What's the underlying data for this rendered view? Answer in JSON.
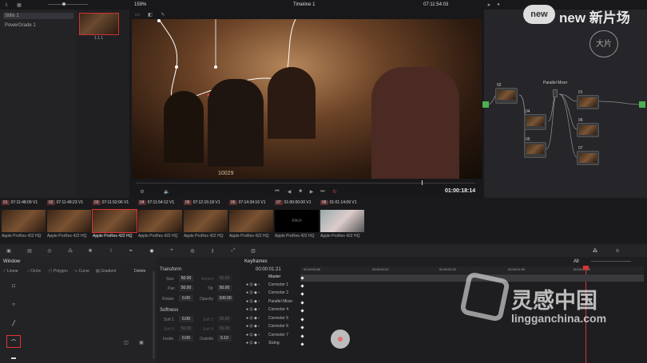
{
  "toolbar": {
    "zoom": "159%",
    "timeline": "Timeline 1",
    "timecode": "07:11:54:03"
  },
  "gallery": {
    "items": [
      "Stills 1",
      "PowerGrade 1"
    ],
    "still_label": "1.1.1"
  },
  "viewer": {
    "overlay_text": "10029",
    "timecode": "01:00:18:14"
  },
  "nodes": {
    "parallel_label": "Parallel Mixer",
    "labels": [
      "02",
      "04",
      "05",
      "01",
      "06",
      "07"
    ]
  },
  "clips": [
    {
      "num": "01",
      "tc": "07:11:48:09",
      "track": "V1",
      "codec": "Apple ProRes 422 HQ"
    },
    {
      "num": "02",
      "tc": "07:11:49:23",
      "track": "V1",
      "codec": "Apple ProRes 422 HQ"
    },
    {
      "num": "03",
      "tc": "07:11:52:06",
      "track": "V1",
      "codec": "Apple ProRes 422 HQ"
    },
    {
      "num": "04",
      "tc": "07:11:54:12",
      "track": "V1",
      "codec": "Apple ProRes 422 HQ"
    },
    {
      "num": "05",
      "tc": "07:12:15:18",
      "track": "V1",
      "codec": "Apple ProRes 422 HQ"
    },
    {
      "num": "06",
      "tc": "07:14:34:16",
      "track": "V1",
      "codec": "Apple ProRes 422 HQ"
    },
    {
      "num": "07",
      "tc": "01:00:00:00",
      "track": "V1",
      "codec": "Apple ProRes 422 HQ",
      "thumb_text": "RAch"
    },
    {
      "num": "08",
      "tc": "01:01:14:09",
      "track": "V1",
      "codec": "Apple ProRes 422 HQ"
    }
  ],
  "window_panel": {
    "title": "Window",
    "tools": [
      "Linear",
      "Circle",
      "Polygon",
      "Curve",
      "Gradient"
    ],
    "delete_label": "Delete"
  },
  "transform": {
    "title": "Transform",
    "size_label": "Size",
    "size": "50.00",
    "aspect_label": "Aspect",
    "aspect": "50.00",
    "pan_label": "Pan",
    "pan": "50.00",
    "tilt_label": "Tilt",
    "tilt": "50.00",
    "rotate_label": "Rotate",
    "rotate": "0.00",
    "opacity_label": "Opacity",
    "opacity": "100.00"
  },
  "softness": {
    "title": "Softness",
    "soft1_label": "Soft 1",
    "soft1": "0.00",
    "soft2_label": "Soft 2",
    "soft2": "50.00",
    "soft3_label": "Soft 3",
    "soft3": "50.00",
    "soft4_label": "Soft 4",
    "soft4": "50.00",
    "inside_label": "Inside",
    "inside": "0.00",
    "outside_label": "Outside",
    "outside": "6.10"
  },
  "keyframes": {
    "title": "Keyframes",
    "filter": "All",
    "timecode": "00:00:01:21",
    "ruler": [
      "00:00:00:00",
      "00:00:00:11",
      "00:00:00:22",
      "00:00:01:09",
      "00:00:01:20"
    ],
    "tracks": [
      "Master",
      "Corrector 1",
      "Corrector 2",
      "Parallel Mixer",
      "Corrector 4",
      "Corrector 5",
      "Corrector 6",
      "Corrector 7",
      "Sizing"
    ]
  },
  "watermark": {
    "brand1": "new 新片场",
    "brand2": "灵感中国",
    "brand2_url": "lingganchina.com"
  }
}
